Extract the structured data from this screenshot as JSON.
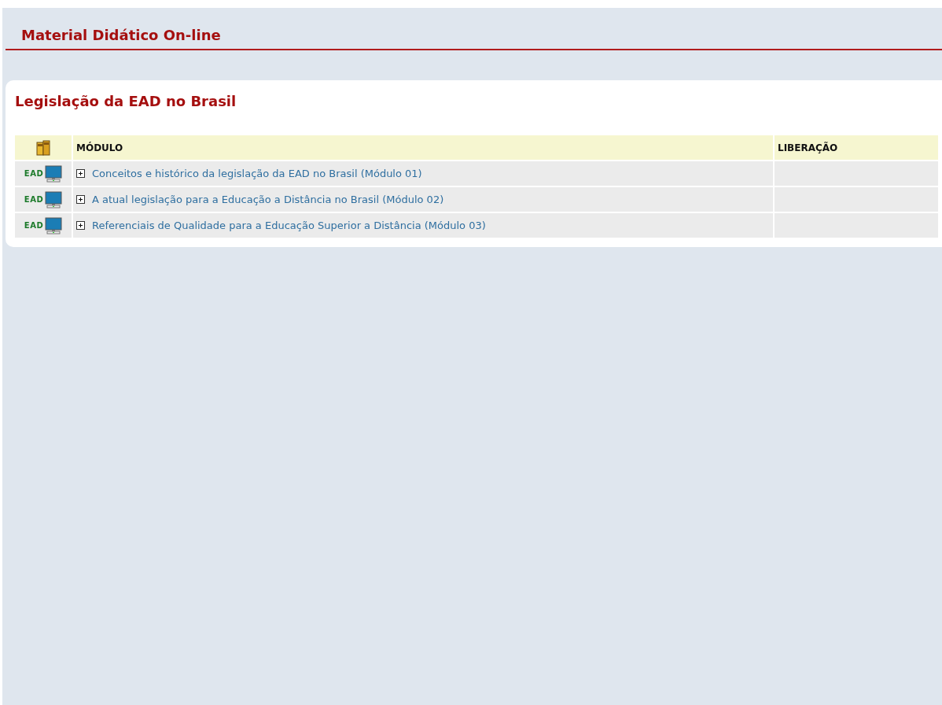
{
  "page_title": "Material Didático On-line",
  "section_title": "Legislação da EAD no Brasil",
  "table": {
    "columns": [
      "MÓDULO",
      "LIBERAÇÃO"
    ],
    "rows": [
      {
        "badge": "EAD",
        "title": "Conceitos e histórico da legislação da EAD no Brasil (Módulo 01)",
        "expanded": false
      },
      {
        "badge": "EAD",
        "title": "A atual legislação para a Educação a Distância no Brasil (Módulo 02)",
        "expanded": false
      },
      {
        "badge": "EAD",
        "title": "Referenciais de Qualidade para a Educação Superior a Distância (Módulo 03)",
        "expanded": false
      }
    ]
  }
}
